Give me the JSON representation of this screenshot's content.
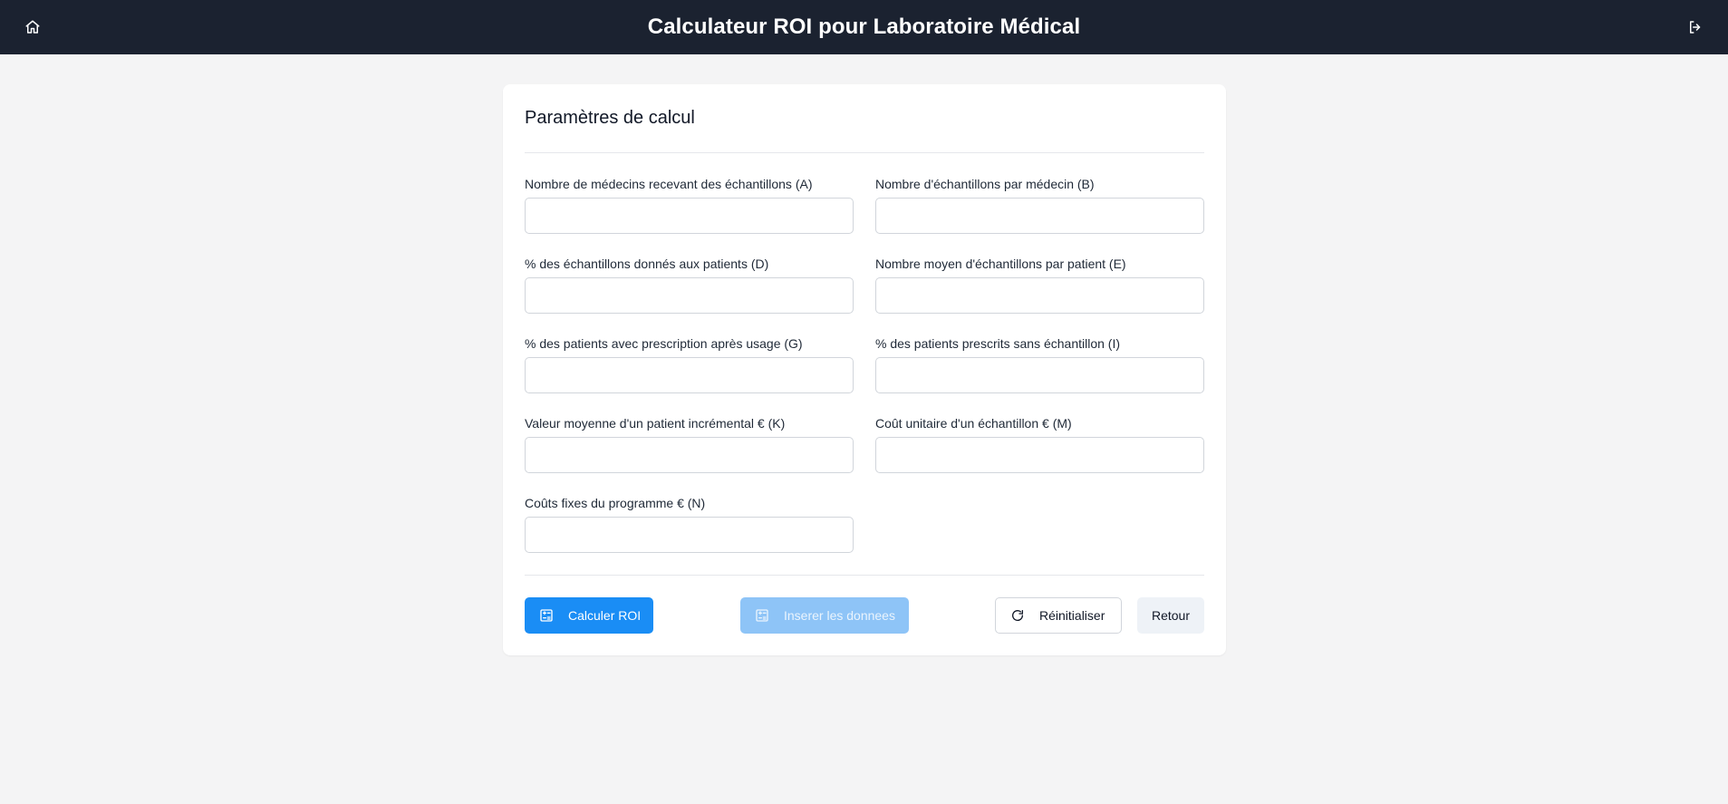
{
  "header": {
    "title": "Calculateur ROI pour Laboratoire Médical",
    "home_icon": "home-icon",
    "logout_icon": "logout-icon",
    "background": "#1b2230"
  },
  "form": {
    "title": "Paramètres de calcul",
    "fields": [
      {
        "label": "Nombre de médecins recevant des échantillons (A)",
        "value": "",
        "placeholder": ""
      },
      {
        "label": "Nombre d'échantillons par médecin (B)",
        "value": "",
        "placeholder": ""
      },
      {
        "label": "% des échantillons donnés aux patients (D)",
        "value": "",
        "placeholder": ""
      },
      {
        "label": "Nombre moyen d'échantillons par patient (E)",
        "value": "",
        "placeholder": ""
      },
      {
        "label": "% des patients avec prescription après usage (G)",
        "value": "",
        "placeholder": ""
      },
      {
        "label": "% des patients prescrits sans échantillon (I)",
        "value": "",
        "placeholder": ""
      },
      {
        "label": "Valeur moyenne d'un patient incrémental € (K)",
        "value": "",
        "placeholder": ""
      },
      {
        "label": "Coût unitaire d'un échantillon € (M)",
        "value": "",
        "placeholder": ""
      },
      {
        "label": "Coûts fixes du programme € (N)",
        "value": "",
        "placeholder": ""
      }
    ]
  },
  "actions": {
    "calculate_label": "Calculer ROI",
    "insert_label": "Inserer les donnees",
    "reset_label": "Réinitialiser",
    "back_label": "Retour",
    "calculate_icon": "calculator-icon",
    "insert_icon": "calculator-icon",
    "reset_icon": "refresh-icon",
    "accent": "#1a8df5"
  }
}
